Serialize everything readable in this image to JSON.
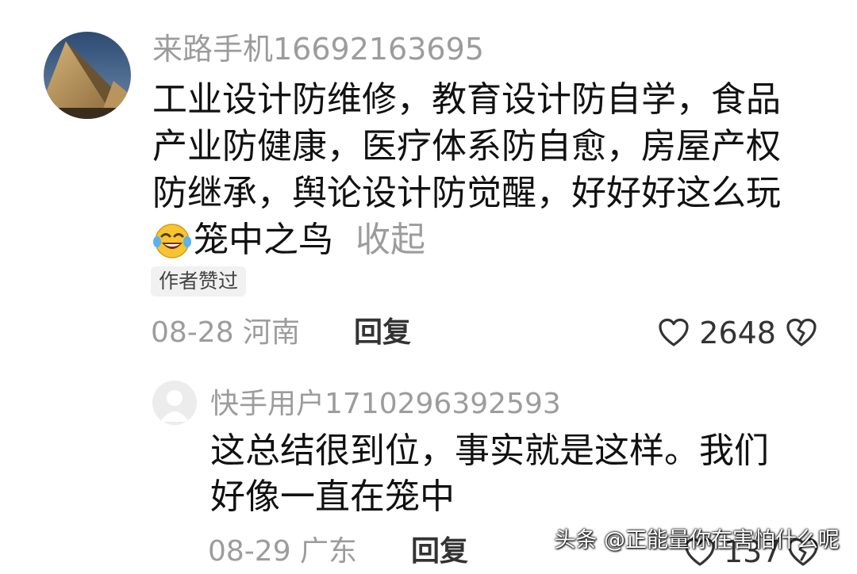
{
  "main_comment": {
    "username": "来路手机16692163695",
    "lines": [
      "工业设计防维修，教育设计防自学，食品",
      "产业防健康，医疗体系防自愈，房屋产权",
      "防继承，舆论设计防觉醒，好好好这么玩"
    ],
    "last_line_text": "笼中之鸟",
    "emoji": "laughing-tears-emoji",
    "collapse_label": "收起",
    "author_badge": "作者赞过",
    "date_location": "08-28 河南",
    "reply_label": "回复",
    "like_count": "2648"
  },
  "reply_comment": {
    "username": "快手用户1710296392593",
    "lines": [
      "这总结很到位，事实就是这样。我们",
      "好像一直在笼中"
    ],
    "date_location": "08-29 广东",
    "reply_label": "回复",
    "like_count": "137"
  },
  "watermark": "头条 @正能量你在害怕什么呢"
}
